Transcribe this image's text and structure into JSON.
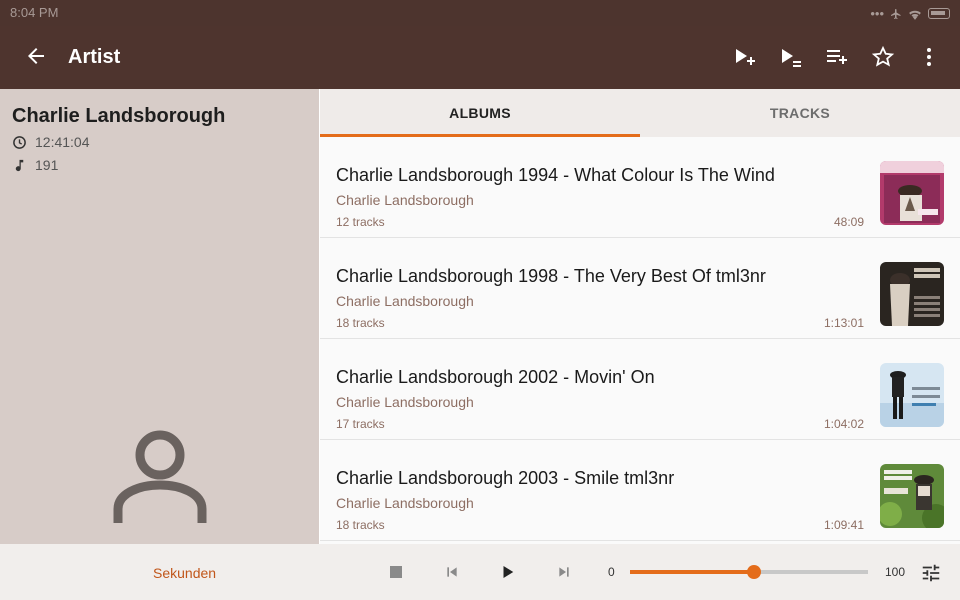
{
  "status": {
    "time": "8:04 PM",
    "dots": "•••"
  },
  "appbar": {
    "title": "Artist"
  },
  "artist": {
    "name": "Charlie Landsborough",
    "duration": "12:41:04",
    "track_count": "191"
  },
  "tabs": [
    {
      "label": "ALBUMS"
    },
    {
      "label": "TRACKS"
    }
  ],
  "albums": [
    {
      "title": "Charlie Landsborough 1994 - What Colour Is The Wind",
      "artist": "Charlie Landsborough",
      "tracks": "12 tracks",
      "duration": "48:09"
    },
    {
      "title": "Charlie Landsborough 1998 - The Very Best Of tml3nr",
      "artist": "Charlie Landsborough",
      "tracks": "18 tracks",
      "duration": "1:13:01"
    },
    {
      "title": "Charlie Landsborough 2002 - Movin' On",
      "artist": "Charlie Landsborough",
      "tracks": "17 tracks",
      "duration": "1:04:02"
    },
    {
      "title": "Charlie Landsborough 2003 - Smile tml3nr",
      "artist": "Charlie Landsborough",
      "tracks": "18 tracks",
      "duration": "1:09:41"
    }
  ],
  "player": {
    "sleep_label": "Sekunden",
    "seek_min": "0",
    "seek_max": "100",
    "seek_value": 52
  },
  "colors": {
    "appbar": "#4e342e",
    "accent": "#e46c1a",
    "sidebar": "#d7ccc8"
  }
}
